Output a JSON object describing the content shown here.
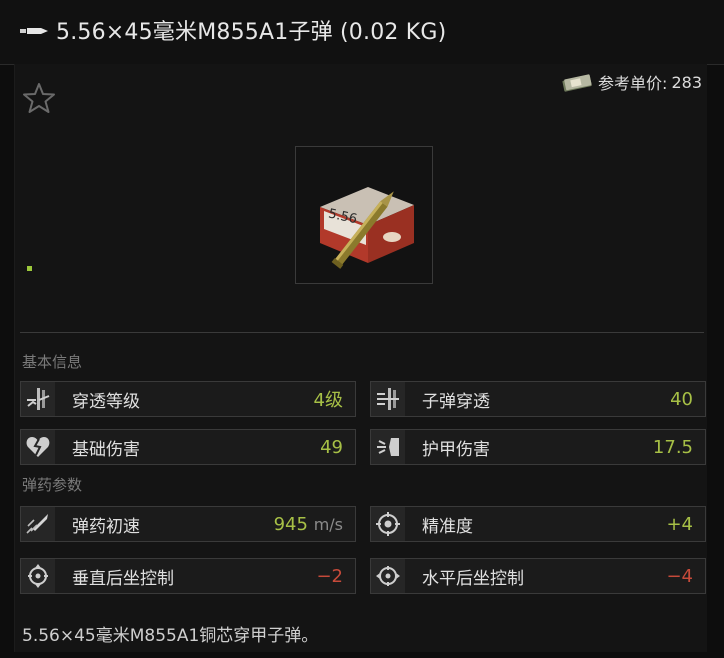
{
  "header": {
    "title": "5.56×45毫米M855A1子弹 (0.02 KG)",
    "icon": "bullet-icon"
  },
  "price": {
    "label": "参考单价:",
    "value": "283",
    "icon": "money-icon"
  },
  "favorite": {
    "icon": "star-icon"
  },
  "sections": {
    "basic_label": "基本信息",
    "ammo_label": "弹药参数"
  },
  "basic": [
    {
      "icon": "penetration-level-icon",
      "label": "穿透等级",
      "value": "4级",
      "color": "#a7c046"
    },
    {
      "icon": "bullet-penetration-icon",
      "label": "子弹穿透",
      "value": "40",
      "color": "#a7c046"
    },
    {
      "icon": "damage-icon",
      "label": "基础伤害",
      "value": "49",
      "color": "#a7c046"
    },
    {
      "icon": "armor-damage-icon",
      "label": "护甲伤害",
      "value": "17.5",
      "color": "#a7c046"
    }
  ],
  "ammo": [
    {
      "icon": "muzzle-velocity-icon",
      "label": "弹药初速",
      "value": "945",
      "unit": "m/s",
      "color": "#a7c046"
    },
    {
      "icon": "accuracy-icon",
      "label": "精准度",
      "value": "+4",
      "color": "#a7c046"
    },
    {
      "icon": "vertical-recoil-icon",
      "label": "垂直后坐控制",
      "value": "−2",
      "color": "#c64a3a"
    },
    {
      "icon": "horizontal-recoil-icon",
      "label": "水平后坐控制",
      "value": "−4",
      "color": "#c64a3a"
    }
  ],
  "description": "5.56×45毫米M855A1铜芯穿甲子弹。"
}
